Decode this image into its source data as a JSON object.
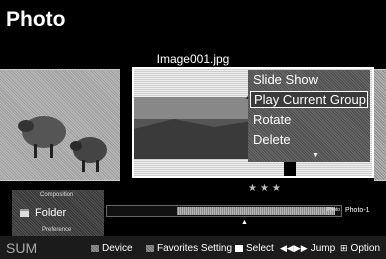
{
  "header": {
    "title": "Photo"
  },
  "viewer": {
    "filename": "Image001.jpg",
    "rating": "★★★",
    "menu": {
      "items": [
        "Slide Show",
        "Play Current Group",
        "Rotate",
        "Delete"
      ],
      "selected_index": 1,
      "more_indicator": "▼"
    }
  },
  "preference": {
    "composition_label": "Composition",
    "folder_label": "Folder",
    "preference_label": "Preference"
  },
  "group": {
    "progress_label": "Photo",
    "current_group": "Photo-1",
    "marker": "▲"
  },
  "footer": {
    "sum": "SUM",
    "device": "Device",
    "favorites": "Favorites Setting",
    "select": "Select",
    "jump": "Jump",
    "option": "Option",
    "jump_glyphs": "◀◀▶▶",
    "option_glyph": "⊞"
  }
}
